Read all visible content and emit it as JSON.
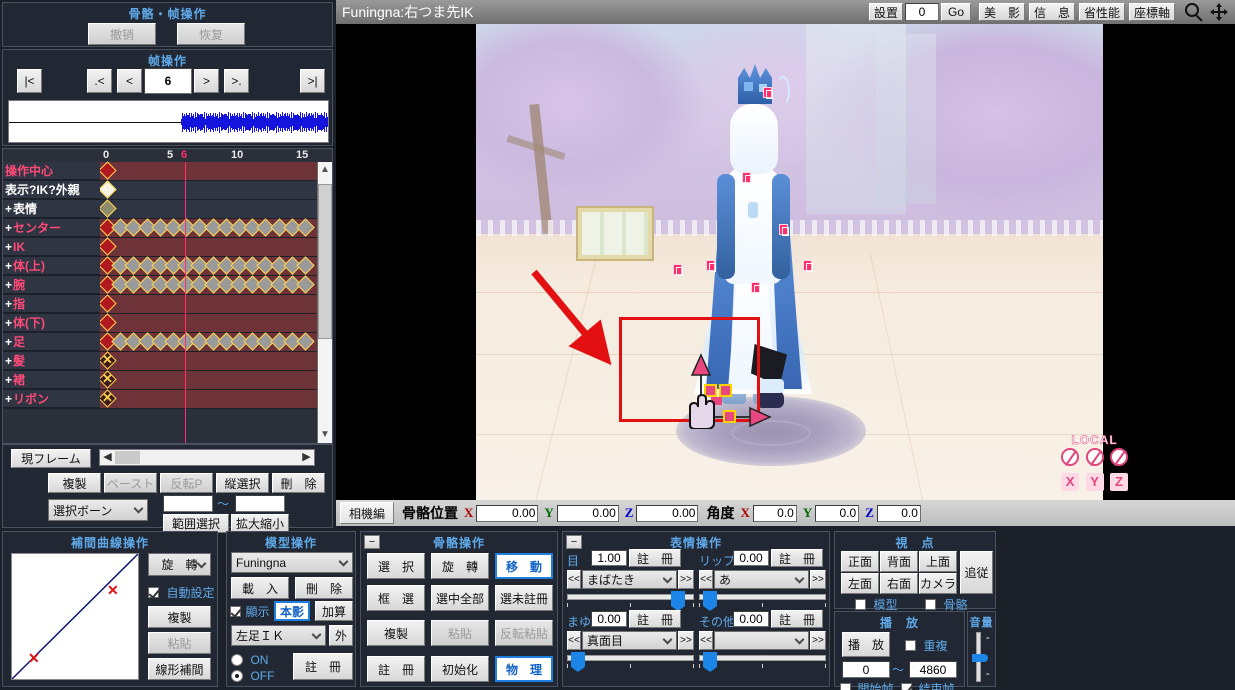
{
  "undo": {
    "title": "骨骼・帧操作",
    "undo_label": "撤销",
    "redo_label": "恢复"
  },
  "frame": {
    "title": "帧操作",
    "first_label": "|<",
    "prevm_label": ".<",
    "prev_label": "<",
    "value": "6",
    "next_label": ">",
    "nextm_label": ">.",
    "last_label": ">|"
  },
  "timeline": {
    "ruler_ticks": [
      "0",
      "5",
      "10",
      "15"
    ],
    "cursor_tick": "6",
    "bones": [
      {
        "label": "操作中心",
        "expandable": false,
        "color": "pink",
        "track": "red",
        "keys": "single-sel"
      },
      {
        "label": "表示?IK?外親",
        "expandable": false,
        "color": "white",
        "track": "dark",
        "keys": "single-white"
      },
      {
        "label": "表情",
        "expandable": true,
        "color": "white",
        "track": "dark",
        "keys": "single-olive"
      },
      {
        "label": "センター",
        "expandable": true,
        "color": "pink",
        "track": "red",
        "keys": "full"
      },
      {
        "label": "IK",
        "expandable": true,
        "color": "pink",
        "track": "red",
        "keys": "single-sel"
      },
      {
        "label": "体(上)",
        "expandable": true,
        "color": "pink",
        "track": "red",
        "keys": "full"
      },
      {
        "label": "腕",
        "expandable": true,
        "color": "pink",
        "track": "red",
        "keys": "full-dense"
      },
      {
        "label": "指",
        "expandable": true,
        "color": "pink",
        "track": "red",
        "keys": "single-sel"
      },
      {
        "label": "体(下)",
        "expandable": true,
        "color": "pink",
        "track": "red",
        "keys": "single-sel"
      },
      {
        "label": "足",
        "expandable": true,
        "color": "pink",
        "track": "red",
        "keys": "full"
      },
      {
        "label": "髪",
        "expandable": true,
        "color": "pink",
        "track": "red",
        "keys": "cross"
      },
      {
        "label": "裙",
        "expandable": true,
        "color": "pink",
        "track": "red",
        "keys": "cross"
      },
      {
        "label": "リボン",
        "expandable": true,
        "color": "pink",
        "track": "red",
        "keys": "cross"
      }
    ]
  },
  "low_controls": {
    "current_frame_label": "現フレーム",
    "copy_label": "複製",
    "paste_label": "ペースト",
    "flipp_label": "反転P",
    "vselect_label": "縦選択",
    "delete_label": "刪　除",
    "bone_select_value": "選択ボーン",
    "range_from": "",
    "range_to": "",
    "range_sep": "〜",
    "range_select_label": "範囲選択",
    "scale_label": "拡大縮小"
  },
  "curve": {
    "title": "補間曲線操作",
    "mode_value": "旋　轉",
    "auto_label": "自動設定",
    "auto_checked": true,
    "copy_label": "複製",
    "paste_label": "粘貼",
    "linear_label": "線形補間"
  },
  "model": {
    "title": "模型操作",
    "model_value": "Funingna",
    "load_label": "載　入",
    "delete_label": "刪　除",
    "display_label": "顯示",
    "display_checked": true,
    "shadow_label": "本影",
    "add_label": "加算",
    "ik_value": "左足ＩＫ",
    "outside_label": "外",
    "on_label": "ON",
    "off_label": "OFF",
    "on_selected": false,
    "register_label": "註　冊"
  },
  "bone_op": {
    "title": "骨骼操作",
    "minimize_label": "−",
    "select_label": "選　択",
    "rotate_label": "旋　轉",
    "move_label": "移　動",
    "boxselect_label": "框　選",
    "selectall_label": "選中全部",
    "selectunreg_label": "選未註冊",
    "copy_label": "複製",
    "paste_label": "粘貼",
    "flippaste_label": "反転粘貼",
    "register_label": "註　冊",
    "init_label": "初始化",
    "physics_label": "物　理",
    "active": [
      "move",
      "physics"
    ],
    "disabled": [
      "paste",
      "flippaste"
    ]
  },
  "expression": {
    "title": "表情操作",
    "minimize_label": "−",
    "groups": [
      {
        "name": "目",
        "value": "1.00",
        "register_label": "註　冊",
        "item": "まばたき",
        "slider_pct": 92
      },
      {
        "name": "リップ",
        "value": "0.00",
        "register_label": "註　冊",
        "item": "あ",
        "slider_pct": 3
      },
      {
        "name": "まゆ",
        "value": "0.00",
        "register_label": "註　冊",
        "item": "真面目",
        "slider_pct": 3
      },
      {
        "name": "その他",
        "value": "0.00",
        "register_label": "註　冊",
        "item": "",
        "slider_pct": 3
      }
    ],
    "prev_label": "<<",
    "next_label": ">>"
  },
  "view": {
    "title": "視　点",
    "front_label": "正面",
    "back_label": "背面",
    "top_label": "上面",
    "left_label": "左面",
    "right_label": "右面",
    "camera_label": "カメラ",
    "follow_label": "追従",
    "model_label": "模型",
    "model_checked": false,
    "bone_label": "骨骼",
    "bone_checked": false
  },
  "play": {
    "title": "播　放",
    "play_label": "播　放",
    "repeat_label": "重複",
    "repeat_checked": false,
    "from": "0",
    "to": "4860",
    "sep": "〜",
    "startframe_label": "開始帧",
    "startframe_checked": false,
    "endframe_label": "結束帧",
    "endframe_checked": true
  },
  "volume": {
    "title": "音量",
    "plus": "-",
    "minus": "-",
    "level_pct": 50
  },
  "viewport": {
    "title": "Funingna:右つま先IK",
    "place_label": "設置",
    "place_value": "0",
    "go_label": "Go",
    "beauty_label": "美　影",
    "info_label": "信　息",
    "perf_label": "省性能",
    "axis_label": "座標軸",
    "search_icon": "magnifier-icon",
    "move_icon": "move-arrows-icon",
    "local_label": "LOCAL",
    "axes": [
      "X",
      "Y",
      "Z"
    ]
  },
  "posbar": {
    "camera_tab_label": "相機編",
    "bone_pos_label": "骨骼位置",
    "pos": [
      {
        "axis": "X",
        "value": "0.00"
      },
      {
        "axis": "Y",
        "value": "0.00"
      },
      {
        "axis": "Z",
        "value": "0.00"
      }
    ],
    "angle_label": "角度",
    "ang": [
      {
        "axis": "X",
        "value": "0.0"
      },
      {
        "axis": "Y",
        "value": "0.0"
      },
      {
        "axis": "Z",
        "value": "0.0"
      }
    ]
  },
  "colors": {
    "accent": "#5fa8e8",
    "key_selected": "#b01820",
    "key_normal": "#9a9a9a",
    "cursor": "#ff2f6e",
    "highlight_box": "#e21010"
  }
}
